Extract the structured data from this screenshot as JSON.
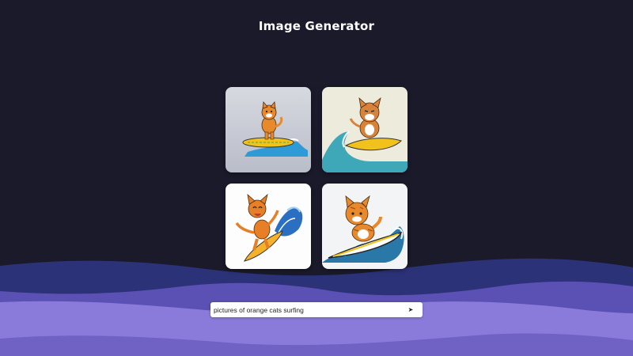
{
  "header": {
    "title": "Image Generator"
  },
  "gallery": {
    "images": [
      {
        "name": "generated-image-1",
        "subject": "cat-on-yellow-surfboard-wave",
        "bg": "#c8ccd6"
      },
      {
        "name": "generated-image-2",
        "subject": "grumpy-cat-surfing-big-wave",
        "bg": "#ecebdc"
      },
      {
        "name": "generated-image-3",
        "subject": "cat-surfing-orange-board-waving",
        "bg": "#fdfdfd"
      },
      {
        "name": "generated-image-4",
        "subject": "tabby-cat-on-surfboard-wave",
        "bg": "#f3f4f6"
      }
    ]
  },
  "prompt": {
    "value": "pictures of orange cats surfing",
    "send_glyph": "➤"
  },
  "theme": {
    "background": "#1a1a2b",
    "wave_dark": "#2a2f72",
    "wave_mid": "#5a4fb0",
    "wave_light": "#8d7ddc",
    "accent_orange": "#e8892c"
  }
}
